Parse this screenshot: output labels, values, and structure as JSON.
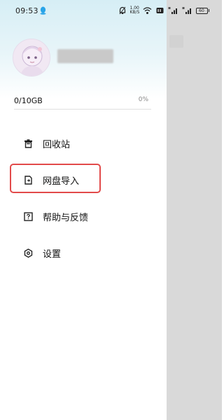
{
  "status_bar": {
    "time": "09:53",
    "net_speed_value": "1.00",
    "net_speed_unit": "KB/S",
    "battery_level": "60"
  },
  "profile": {
    "storage_used": "0/10GB",
    "storage_percent": "0%"
  },
  "menu": {
    "items": [
      {
        "label": "回收站",
        "icon": "trash-icon"
      },
      {
        "label": "网盘导入",
        "icon": "import-file-icon"
      },
      {
        "label": "帮助与反馈",
        "icon": "help-icon"
      },
      {
        "label": "设置",
        "icon": "settings-icon"
      }
    ]
  },
  "colors": {
    "accent": "#e24a4a",
    "header_gradient_top": "#d6eef5"
  }
}
